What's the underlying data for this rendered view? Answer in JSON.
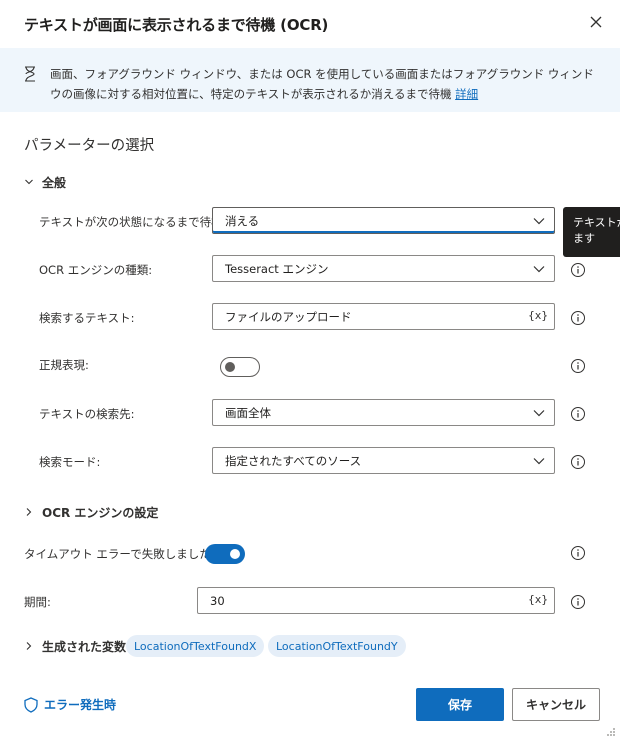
{
  "dialog": {
    "title": "テキストが画面に表示されるまで待機 (OCR)",
    "close_icon": "close-icon"
  },
  "info": {
    "icon": "hourglass-icon",
    "message": "画面、フォアグラウンド ウィンドウ、または OCR を使用している画面またはフォアグラウンド ウィンドウの画像に対する相対位置に、特定のテキストが表示されるか消えるまで待機",
    "link": "詳細"
  },
  "parameters": {
    "title": "パラメーターの選択",
    "general_group": "全般",
    "fields": [
      {
        "label": "テキストが次の状態になるまで待機:",
        "value": "消える",
        "type": "dropdown"
      },
      {
        "label": "OCR エンジンの種類:",
        "value": "Tesseract エンジン",
        "type": "dropdown"
      },
      {
        "label": "検索するテキスト:",
        "value": "ファイルのアップロード",
        "type": "text",
        "var_label": "{x}"
      },
      {
        "label": "正規表現:",
        "value": false,
        "type": "toggle"
      },
      {
        "label": "テキストの検索先:",
        "value": "画面全体",
        "type": "dropdown"
      },
      {
        "label": "検索モード:",
        "value": "指定されたすべてのソース",
        "type": "dropdown"
      }
    ],
    "tooltip_text": "テキストが\nます",
    "ocr_group": "OCR エンジンの設定",
    "timeout": {
      "label": "タイムアウト エラーで失敗しました:",
      "value": true
    },
    "duration": {
      "label": "期間:",
      "value": "30",
      "var_label": "{x}"
    },
    "variables": {
      "label": "生成された変数",
      "items": [
        "LocationOfTextFoundX",
        "LocationOfTextFoundY"
      ]
    }
  },
  "footer": {
    "on_error": "エラー発生時",
    "save": "保存",
    "cancel": "キャンセル"
  },
  "colors": {
    "accent": "#0f6cbd",
    "info_bg": "#eff6fc",
    "chip_bg": "#e5eef8"
  }
}
